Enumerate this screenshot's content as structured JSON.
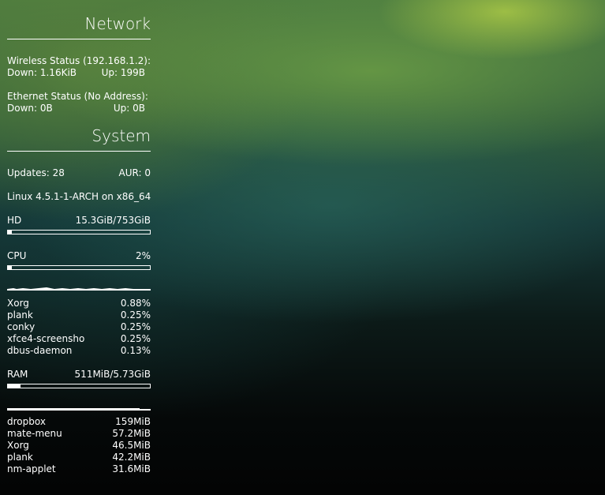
{
  "network": {
    "title": "Network",
    "wireless": {
      "label": "Wireless Status (192.168.1.2):",
      "down": "Down: 1.16KiB",
      "up": "Up: 199B"
    },
    "ethernet": {
      "label": "Ethernet Status (No Address):",
      "down": "Down: 0B",
      "up": "Up: 0B"
    }
  },
  "system": {
    "title": "System",
    "updates": "Updates: 28",
    "aur": "AUR: 0",
    "kernel": "Linux 4.5.1-1-ARCH on x86_64",
    "hd": {
      "label": "HD",
      "value": "15.3GiB/753GiB",
      "fraction": 0.02
    },
    "cpu": {
      "label": "CPU",
      "value": "2%",
      "fraction": 0.02,
      "processes": [
        {
          "name": "Xorg",
          "value": "0.88%"
        },
        {
          "name": "plank",
          "value": "0.25%"
        },
        {
          "name": "conky",
          "value": "0.25%"
        },
        {
          "name": "xfce4-screensho",
          "value": "0.25%"
        },
        {
          "name": "dbus-daemon",
          "value": "0.13%"
        }
      ]
    },
    "ram": {
      "label": "RAM",
      "value": "511MiB/5.73GiB",
      "fraction": 0.087,
      "processes": [
        {
          "name": "dropbox",
          "value": "159MiB"
        },
        {
          "name": "mate-menu",
          "value": "57.2MiB"
        },
        {
          "name": "Xorg",
          "value": "46.5MiB"
        },
        {
          "name": "plank",
          "value": "42.2MiB"
        },
        {
          "name": "nm-applet",
          "value": "31.6MiB"
        }
      ]
    }
  }
}
